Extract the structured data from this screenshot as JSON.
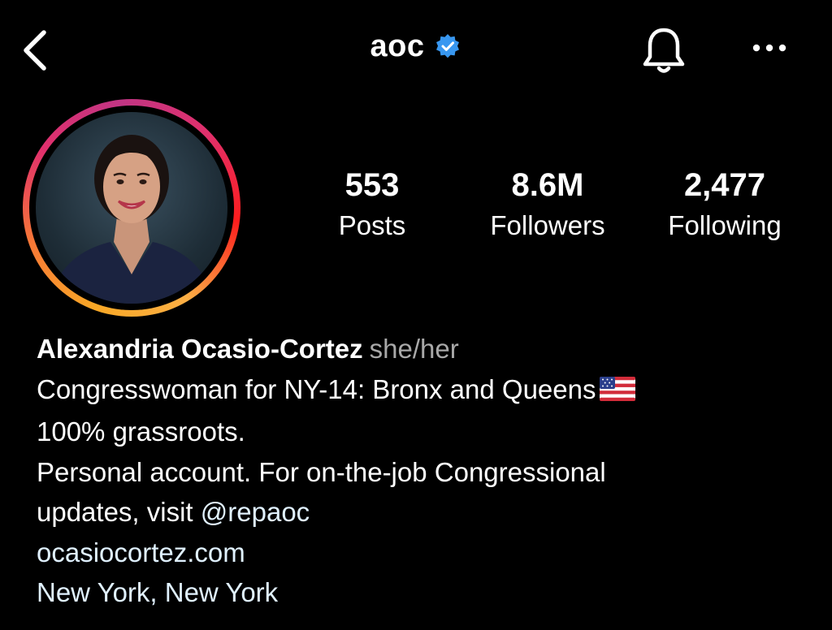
{
  "header": {
    "username": "aoc",
    "verified": true,
    "icons": [
      "back-chevron-icon",
      "verified-badge-icon",
      "bell-icon",
      "more-dots-icon"
    ]
  },
  "stats": [
    {
      "value": "553",
      "label": "Posts"
    },
    {
      "value": "8.6M",
      "label": "Followers"
    },
    {
      "value": "2,477",
      "label": "Following"
    }
  ],
  "profile": {
    "name": "Alexandria Ocasio-Cortez",
    "pronouns": "she/her",
    "bio_line1": "Congresswoman for NY-14: Bronx and Queens",
    "bio_flag": "us-flag-emoji",
    "bio_line2": "100% grassroots.",
    "bio_line3": "Personal account. For on-the-job Congressional",
    "bio_line4_prefix": "updates, visit ",
    "bio_mention": "@repaoc",
    "website": "ocasiocortez.com",
    "location": "New York, New York"
  },
  "colors": {
    "background": "#000000",
    "text": "#ffffff",
    "muted": "#a8a8a8",
    "link": "#e0f1ff",
    "verified": "#3897f0",
    "story_ring": [
      "#fcaf45",
      "#f77737",
      "#e1306c",
      "#c13584"
    ]
  }
}
